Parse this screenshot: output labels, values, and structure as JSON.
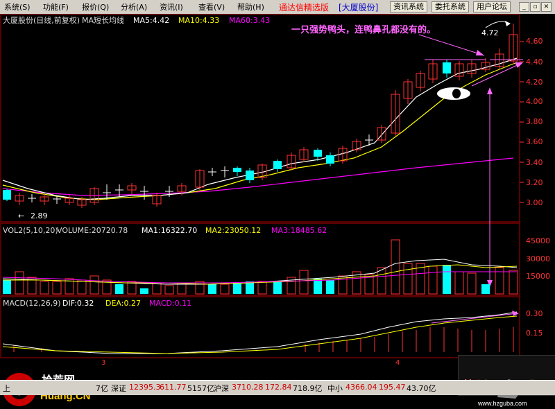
{
  "menu": {
    "items": [
      "系统(S)",
      "功能(F)",
      "报价(Q)",
      "分析(A)",
      "资讯(I)",
      "查看(V)",
      "帮助(H)"
    ],
    "app_title": "通达信精选版",
    "stock_title": "[大厦股份]",
    "buttons": [
      "资讯系统",
      "委托系统",
      "用户论坛"
    ]
  },
  "price_panel": {
    "header": {
      "name": "大厦股份(日线,前复权)",
      "indicator": "MA短长均线",
      "ma5": "MA5:4.42",
      "ma10": "MA10:4.33",
      "ma60": "MA60:3.43"
    },
    "annotation": "一只强势鸭头，连鸭鼻孔都没有的。",
    "high_label": "4.72",
    "low_label": "2.89",
    "y_ticks": [
      "4.60",
      "4.40",
      "4.20",
      "4.00",
      "3.80",
      "3.60",
      "3.40",
      "3.20",
      "3.00"
    ]
  },
  "volume_panel": {
    "header": {
      "name": "VOL2(5,10,20)",
      "volume": "VOLUME:20720.78",
      "ma1": "MA1:16322.70",
      "ma2": "MA2:23050.12",
      "ma3": "MA3:18485.62"
    },
    "y_ticks": [
      "45000",
      "30000",
      "15000"
    ]
  },
  "macd_panel": {
    "header": {
      "name": "MACD(12,26,9)",
      "dif": "DIF:0.32",
      "dea": "DEA:0.27",
      "macd": "MACD:0.11"
    },
    "y_ticks": [
      "0.30",
      "0.15"
    ],
    "month_labels": [
      "3",
      "4"
    ]
  },
  "status_bar": {
    "sh_label": "上",
    "sh_tail": "7亿",
    "sz_label": "深证",
    "sz_index": "12395.3",
    "sz_change": "611.77",
    "sz_amount": "5157亿",
    "hs_label": "沪深",
    "hs_index": "3710.28",
    "hs_change": "172.84",
    "hs_amount": "718.9亿",
    "zx_label": "中小",
    "zx_index": "4366.04",
    "zx_change": "195.47",
    "zx_amount": "43.70亿"
  },
  "watermarks": {
    "left_logo": "10 拾荒网 Huang.CN",
    "right_logo": "杭州 股吧 www.hzguba.com"
  },
  "colors": {
    "up": "#ff3232",
    "down": "#00ffff",
    "ma5": "#ffffff",
    "ma10": "#ffff00",
    "ma60": "#ff00ff",
    "annotation": "#ff66ff"
  }
}
